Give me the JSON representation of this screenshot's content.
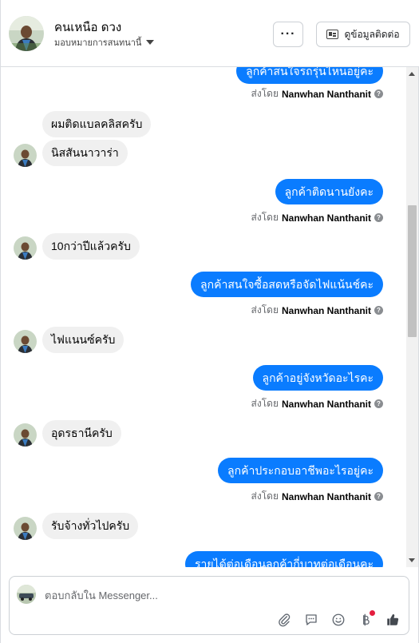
{
  "header": {
    "contact_name": "คนเหนือ ดวง",
    "assign_label": "มอบหมายการสนทนานี้",
    "more_label": "···",
    "view_contact_label": "ดูข้อมูลติดต่อ"
  },
  "messages": [
    {
      "dir": "out",
      "text": "ลูกค้าสนใจรถรุ่นไหนอยู่คะ"
    },
    {
      "dir": "sent_by",
      "prefix": "ส่งโดย",
      "name": "Nanwhan Nanthanit"
    },
    {
      "dir": "in",
      "text": "ผมติดแบลคลิสครับ"
    },
    {
      "dir": "in",
      "text": "นิสสันนาวาร่า"
    },
    {
      "dir": "out",
      "text": "ลูกค้าติดนานยังคะ"
    },
    {
      "dir": "sent_by",
      "prefix": "ส่งโดย",
      "name": "Nanwhan Nanthanit"
    },
    {
      "dir": "in",
      "text": "10กว่าปีแล้วครับ"
    },
    {
      "dir": "out",
      "text": "ลูกค้าสนใจซื้อสดหรือจัดไฟแน้นช์คะ"
    },
    {
      "dir": "sent_by",
      "prefix": "ส่งโดย",
      "name": "Nanwhan Nanthanit"
    },
    {
      "dir": "in",
      "text": "ไฟแนนซ์ครับ"
    },
    {
      "dir": "out",
      "text": "ลูกค้าอยู่จังหวัดอะไรคะ"
    },
    {
      "dir": "sent_by",
      "prefix": "ส่งโดย",
      "name": "Nanwhan Nanthanit"
    },
    {
      "dir": "in",
      "text": "อุดรธานีครับ"
    },
    {
      "dir": "out",
      "text": "ลูกค้าประกอบอาชีพอะไรอยู่คะ"
    },
    {
      "dir": "sent_by",
      "prefix": "ส่งโดย",
      "name": "Nanwhan Nanthanit"
    },
    {
      "dir": "in",
      "text": "รับจ้างทั่วไปครับ"
    },
    {
      "dir": "out",
      "text": "รายได้ต่อเดือนลูกค้ากี่บาทต่อเดือนคะ"
    }
  ],
  "composer": {
    "placeholder": "ตอบกลับใน Messenger...",
    "tools": [
      "paperclip-icon",
      "saved-reply-icon",
      "emoji-icon",
      "baht-icon",
      "thumbs-up-icon"
    ]
  },
  "colors": {
    "outgoing_bubble": "#0a7cff",
    "incoming_bubble": "#f0f0f0",
    "notification_dot": "#e41e3f"
  }
}
